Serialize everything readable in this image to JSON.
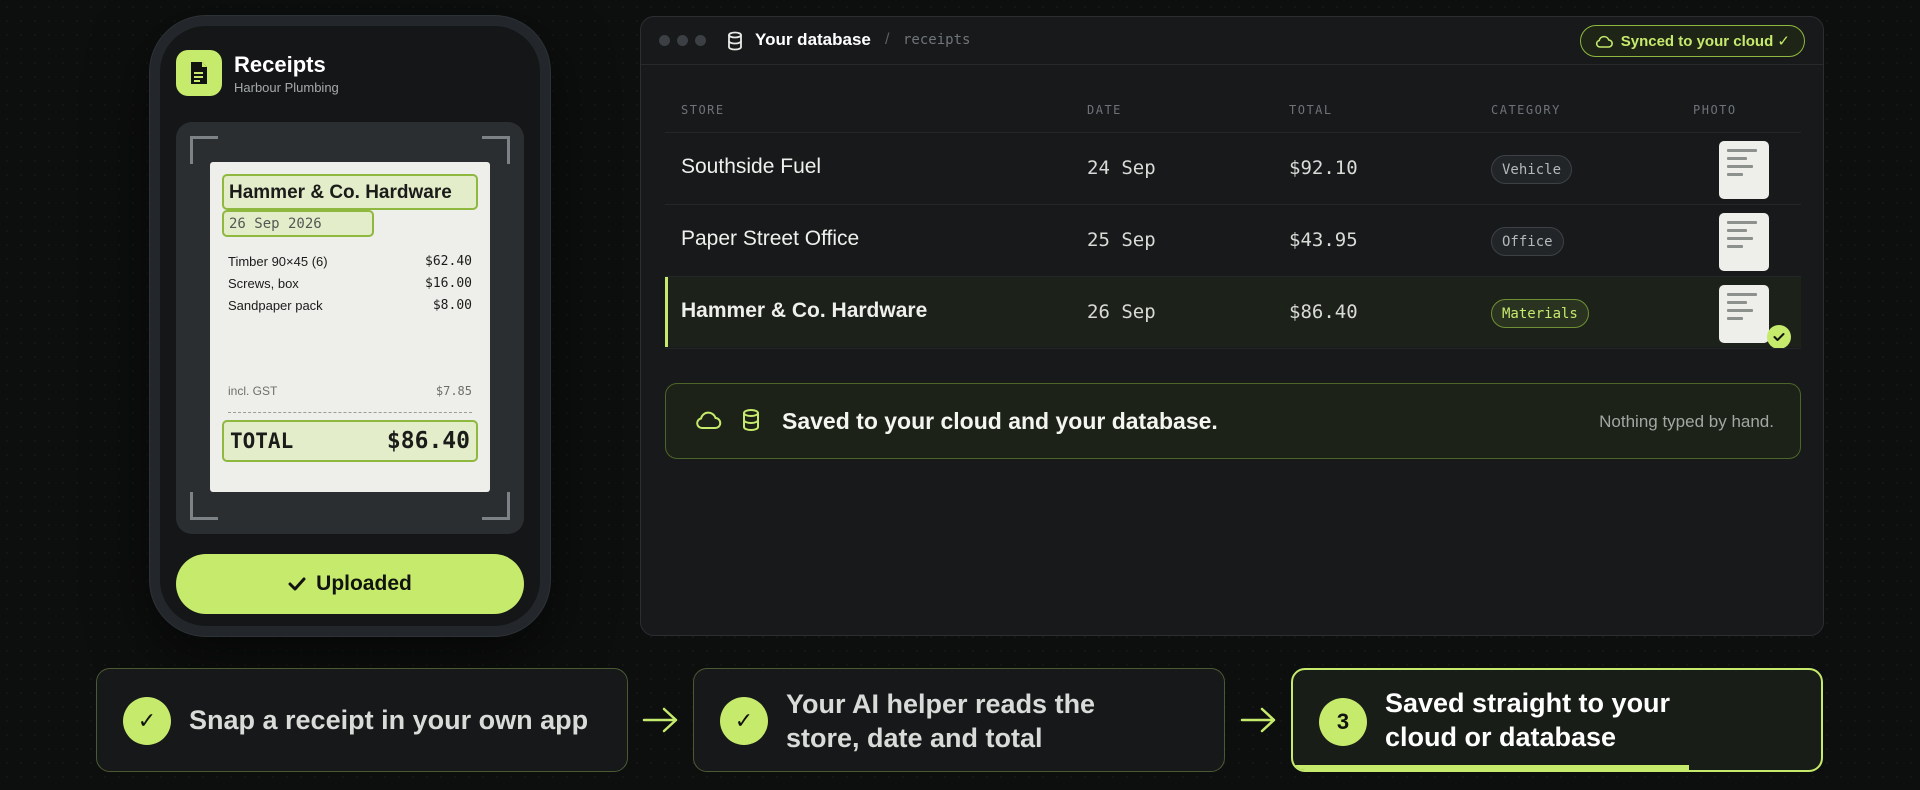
{
  "phone": {
    "app_title": "Receipts",
    "app_subtitle": "Harbour Plumbing",
    "receipt": {
      "store": "Hammer & Co. Hardware",
      "date": "26 Sep 2026",
      "items": [
        {
          "name": "Timber 90×45 (6)",
          "price": "$62.40"
        },
        {
          "name": "Screws, box",
          "price": "$16.00"
        },
        {
          "name": "Sandpaper pack",
          "price": "$8.00"
        }
      ],
      "gst_label": "incl. GST",
      "gst_value": "$7.85",
      "total_label": "TOTAL",
      "total_value": "$86.40"
    },
    "upload_label": "Uploaded"
  },
  "database": {
    "title": "Your database",
    "separator": "/",
    "path": "receipts",
    "sync_label": "Synced to your cloud ✓",
    "columns": [
      "STORE",
      "DATE",
      "TOTAL",
      "CATEGORY",
      "PHOTO"
    ],
    "rows": [
      {
        "store": "Southside Fuel",
        "date": "24 Sep",
        "total": "$92.10",
        "category": "Vehicle"
      },
      {
        "store": "Paper Street Office",
        "date": "25 Sep",
        "total": "$43.95",
        "category": "Office"
      },
      {
        "store": "Hammer & Co. Hardware",
        "date": "26 Sep",
        "total": "$86.40",
        "category": "Materials"
      }
    ],
    "saved_message": "Saved to your cloud and your database.",
    "saved_note": "Nothing typed by hand."
  },
  "steps": [
    {
      "marker": "✓",
      "text": "Snap a receipt in your own app"
    },
    {
      "marker": "✓",
      "text_line1": "Your AI helper reads the",
      "text_line2": "store, date and total"
    },
    {
      "marker": "3",
      "text_line1": "Saved straight to your",
      "text_line2": "cloud or database",
      "progress": 0.75
    }
  ],
  "colors": {
    "accent": "#c6ea6c",
    "background": "#0d0f0e",
    "panel": "#17191b"
  },
  "icons": [
    "document-icon",
    "database-icon",
    "cloud-icon",
    "check-icon",
    "arrow-right-icon"
  ]
}
